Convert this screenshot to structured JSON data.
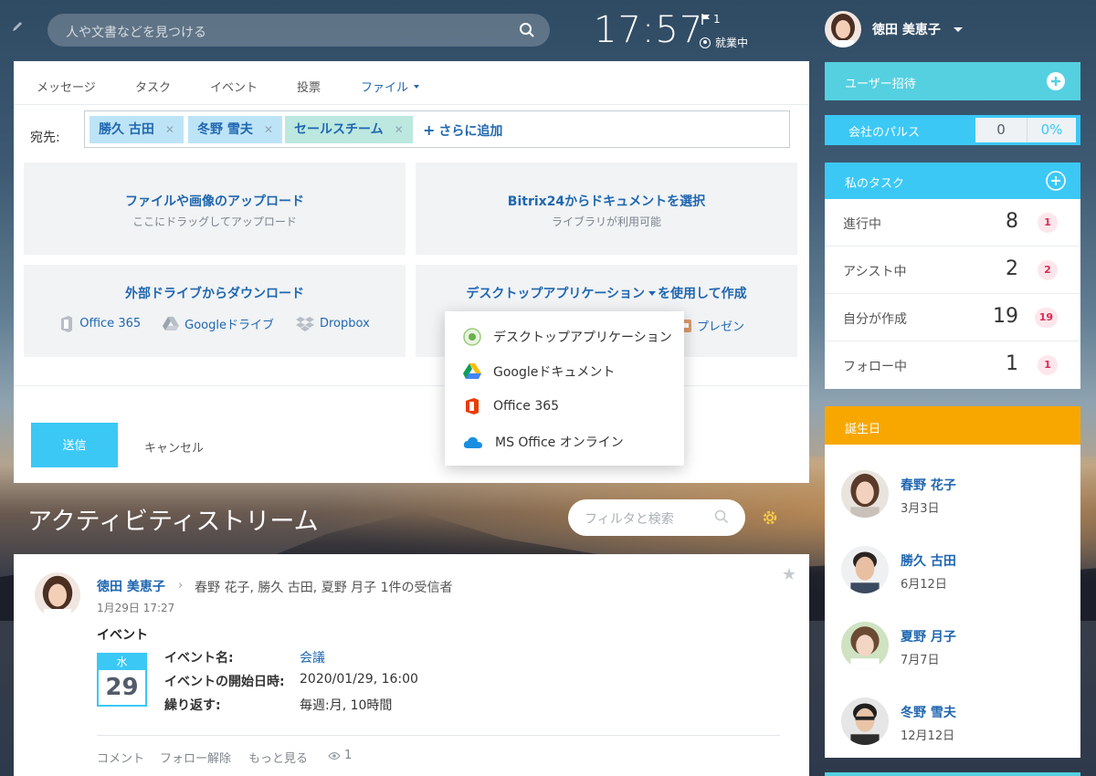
{
  "header": {
    "search_placeholder": "人や文書などを見つける",
    "time": "17:57",
    "flag_count": "1",
    "work_status": "就業中",
    "user_name": "徳田 美恵子"
  },
  "composer": {
    "tabs": [
      "メッセージ",
      "タスク",
      "イベント",
      "投票",
      "ファイル"
    ],
    "to_label": "宛先:",
    "recipients": [
      "勝久 古田",
      "冬野 雪夫",
      "セールスチーム"
    ],
    "add_more": "さらに追加",
    "upload_title": "ファイルや画像のアップロード",
    "upload_sub": "ここにドラッグしてアップロード",
    "bitrix_title": "Bitrix24からドキュメントを選択",
    "bitrix_sub": "ライブラリが利用可能",
    "external_title": "外部ドライブからダウンロード",
    "drives": [
      "Office 365",
      "Googleドライブ",
      "Dropbox"
    ],
    "desktop_title_a": "デスクトップアプリケーション",
    "desktop_title_b": "を使用して作成",
    "presentation": "プレゼン",
    "send": "送信",
    "cancel": "キャンセル",
    "dropdown": [
      "デスクトップアプリケーション",
      "Googleドキュメント",
      "Office 365",
      "MS Office オンライン"
    ]
  },
  "stream": {
    "title": "アクティビティストリーム",
    "filter_placeholder": "フィルタと検索",
    "post": {
      "author": "徳田 美恵子",
      "recipients": "春野 花子, 勝久 古田, 夏野 月子  1件の受信者",
      "date": "1月29日 17:27",
      "event_header": "イベント",
      "cal_weekday": "水",
      "cal_day": "29",
      "labels": [
        "イベント名:",
        "イベントの開始日時:",
        "繰り返す:"
      ],
      "values": [
        "会議",
        "2020/01/29, 16:00",
        "毎週:月, 10時間"
      ],
      "actions": [
        "コメント",
        "フォロー解除",
        "もっと見る"
      ],
      "views": "1"
    }
  },
  "sidebar": {
    "invite": "ユーザー招待",
    "pulse_label": "会社のパルス",
    "pulse_value": "0",
    "pulse_percent": "0%",
    "tasks_title": "私のタスク",
    "tasks": [
      {
        "label": "進行中",
        "count": "8",
        "badge": "1"
      },
      {
        "label": "アシスト中",
        "count": "2",
        "badge": "2"
      },
      {
        "label": "自分が作成",
        "count": "19",
        "badge": "19"
      },
      {
        "label": "フォロー中",
        "count": "1",
        "badge": "1"
      }
    ],
    "birthday_title": "誕生日",
    "birthdays": [
      {
        "name": "春野 花子",
        "date": "3月3日"
      },
      {
        "name": "勝久 古田",
        "date": "6月12日"
      },
      {
        "name": "夏野 月子",
        "date": "7月7日"
      },
      {
        "name": "冬野 雪夫",
        "date": "12月12日"
      }
    ]
  },
  "colors": {
    "accent": "#3bc8f5",
    "link": "#2067b0",
    "birthday": "#f7a700",
    "badge": "#e02852"
  }
}
